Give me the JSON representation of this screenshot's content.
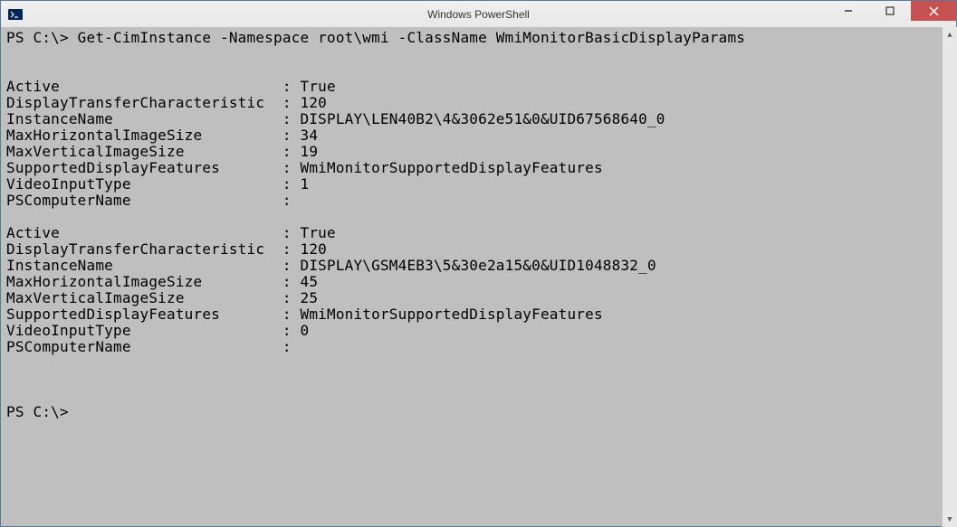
{
  "window": {
    "title": "Windows PowerShell"
  },
  "terminal": {
    "prompt": "PS C:\\>",
    "command": "Get-CimInstance -Namespace root\\wmi -ClassName WmiMonitorBasicDisplayParams",
    "blocks": [
      {
        "rows": [
          {
            "key": "Active",
            "value": "True"
          },
          {
            "key": "DisplayTransferCharacteristic",
            "value": "120"
          },
          {
            "key": "InstanceName",
            "value": "DISPLAY\\LEN40B2\\4&3062e51&0&UID67568640_0"
          },
          {
            "key": "MaxHorizontalImageSize",
            "value": "34"
          },
          {
            "key": "MaxVerticalImageSize",
            "value": "19"
          },
          {
            "key": "SupportedDisplayFeatures",
            "value": "WmiMonitorSupportedDisplayFeatures"
          },
          {
            "key": "VideoInputType",
            "value": "1"
          },
          {
            "key": "PSComputerName",
            "value": ""
          }
        ]
      },
      {
        "rows": [
          {
            "key": "Active",
            "value": "True"
          },
          {
            "key": "DisplayTransferCharacteristic",
            "value": "120"
          },
          {
            "key": "InstanceName",
            "value": "DISPLAY\\GSM4EB3\\5&30e2a15&0&UID1048832_0"
          },
          {
            "key": "MaxHorizontalImageSize",
            "value": "45"
          },
          {
            "key": "MaxVerticalImageSize",
            "value": "25"
          },
          {
            "key": "SupportedDisplayFeatures",
            "value": "WmiMonitorSupportedDisplayFeatures"
          },
          {
            "key": "VideoInputType",
            "value": "0"
          },
          {
            "key": "PSComputerName",
            "value": ""
          }
        ]
      }
    ],
    "key_col_width": 30
  }
}
